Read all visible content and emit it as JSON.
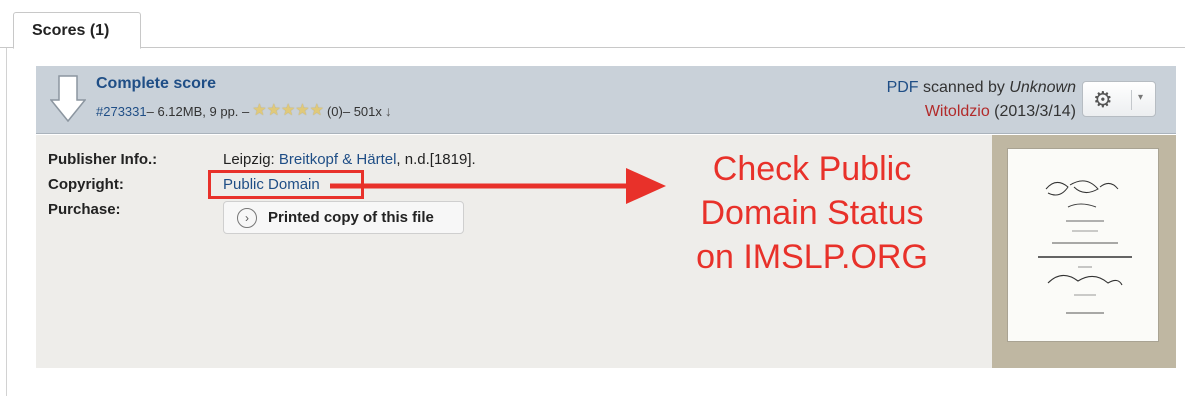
{
  "tabs": [
    {
      "label": "Scores (1)"
    }
  ],
  "score": {
    "title": "Complete score",
    "id": "#273331",
    "size_pages": " – 6.12MB, 9 pp. – ",
    "rating": {
      "stars": 5,
      "count": "(0)"
    },
    "downloads": " – 501x",
    "format_link": "PDF",
    "scanned_by_text": " scanned by ",
    "scanner": "Unknown",
    "uploader": "Witoldzio",
    "date": " (2013/3/14)"
  },
  "details": {
    "publisher_label": "Publisher Info.:",
    "publisher_city": "Leipzig: ",
    "publisher_name": "Breitkopf & Härtel",
    "publisher_date": ", n.d.[1819].",
    "copyright_label": "Copyright:",
    "copyright_value": "Public Domain",
    "purchase_label": "Purchase:",
    "purchase_button": "Printed copy of this file"
  },
  "annotation": {
    "text": "Check Public Domain Status on IMSLP.ORG",
    "color": "#e8312a"
  },
  "icons": [
    "download-arrow-icon",
    "star-icon",
    "download-count-icon",
    "gear-icon",
    "chevron-down-icon",
    "chevron-right-circle-icon"
  ],
  "colors": {
    "link": "#1f4e86",
    "header_bg": "#c9d1d9",
    "details_bg": "#eeedea",
    "uploader": "#b22a2a"
  }
}
